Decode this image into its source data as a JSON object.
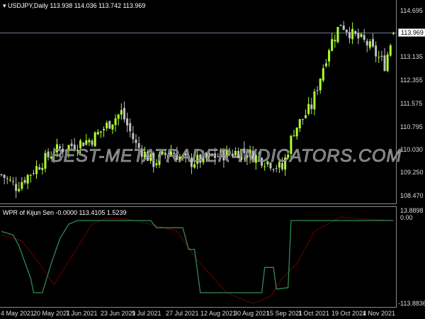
{
  "main_title": "USDJPY,Daily  113.938 114.036 113.742 113.969",
  "current_price": "113.969",
  "price_labels": [
    "114.695",
    "113.135",
    "112.355",
    "111.575",
    "110.795",
    "110.030",
    "109.250",
    "108.470"
  ],
  "watermark": "BEST-METATRADER-INDICATORS.COM",
  "indicator_title": "WPR of Kijun Sen -0.0000 113.4105 1.5239",
  "indicator_labels": {
    "max": "13.8898",
    "zero": "0.00",
    "min": "-113.8836"
  },
  "date_labels": [
    "4 May 2021",
    "20 May 2021",
    "7 Jun 2021",
    "23 Jun 2021",
    "9 Jul 2021",
    "27 Jul 2021",
    "12 Aug 2021",
    "30 Aug 2021",
    "15 Sep 2021",
    "1 Oct 2021",
    "19 Oct 2021",
    "4 Nov 2021"
  ],
  "colors": {
    "bull": "#adff2f",
    "bear": "#c0c0c0",
    "wpr": "#2e8b57",
    "signal": "#cc0000"
  },
  "chart_data": {
    "type": "candlestick",
    "symbol": "USDJPY",
    "timeframe": "Daily",
    "bars": 135,
    "price_range": [
      108.2,
      114.9
    ],
    "close_keypoints": [
      [
        0,
        109.2
      ],
      [
        5,
        108.8
      ],
      [
        18,
        110.0
      ],
      [
        31,
        110.4
      ],
      [
        41,
        111.3
      ],
      [
        46,
        110.2
      ],
      [
        52,
        109.6
      ],
      [
        58,
        110.0
      ],
      [
        64,
        109.6
      ],
      [
        72,
        109.8
      ],
      [
        82,
        110.0
      ],
      [
        92,
        109.6
      ],
      [
        96,
        109.4
      ],
      [
        100,
        110.7
      ],
      [
        106,
        111.5
      ],
      [
        112,
        113.5
      ],
      [
        116,
        114.3
      ],
      [
        120,
        113.9
      ],
      [
        125,
        113.6
      ],
      [
        131,
        112.9
      ],
      [
        134,
        113.969
      ]
    ],
    "indicator": {
      "range": [
        -113.8836,
        13.8898
      ],
      "wpr_keypoints": [
        [
          0,
          -15
        ],
        [
          4,
          -20
        ],
        [
          6,
          -35
        ],
        [
          10,
          -80
        ],
        [
          11,
          -100
        ],
        [
          14,
          -100
        ],
        [
          17,
          -60
        ],
        [
          20,
          -25
        ],
        [
          23,
          -5
        ],
        [
          26,
          0
        ],
        [
          51,
          0
        ],
        [
          53,
          -10
        ],
        [
          62,
          -10
        ],
        [
          64,
          -40
        ],
        [
          66,
          -40
        ],
        [
          68,
          -100
        ],
        [
          89,
          -100
        ],
        [
          90,
          -65
        ],
        [
          93,
          -65
        ],
        [
          94,
          -95
        ],
        [
          98,
          -93
        ],
        [
          99,
          0
        ],
        [
          134,
          0
        ]
      ],
      "signal_keypoints": [
        [
          0,
          -20
        ],
        [
          7,
          -28
        ],
        [
          13,
          -60
        ],
        [
          18,
          -89
        ],
        [
          24,
          -50
        ],
        [
          31,
          -5
        ],
        [
          36,
          3
        ],
        [
          43,
          2
        ],
        [
          51,
          -5
        ],
        [
          60,
          -15
        ],
        [
          67,
          -55
        ],
        [
          77,
          -100
        ],
        [
          86,
          -115
        ],
        [
          92,
          -105
        ],
        [
          96,
          -80
        ],
        [
          101,
          -60
        ],
        [
          107,
          -15
        ],
        [
          116,
          5
        ],
        [
          125,
          2
        ],
        [
          134,
          0
        ]
      ]
    }
  }
}
